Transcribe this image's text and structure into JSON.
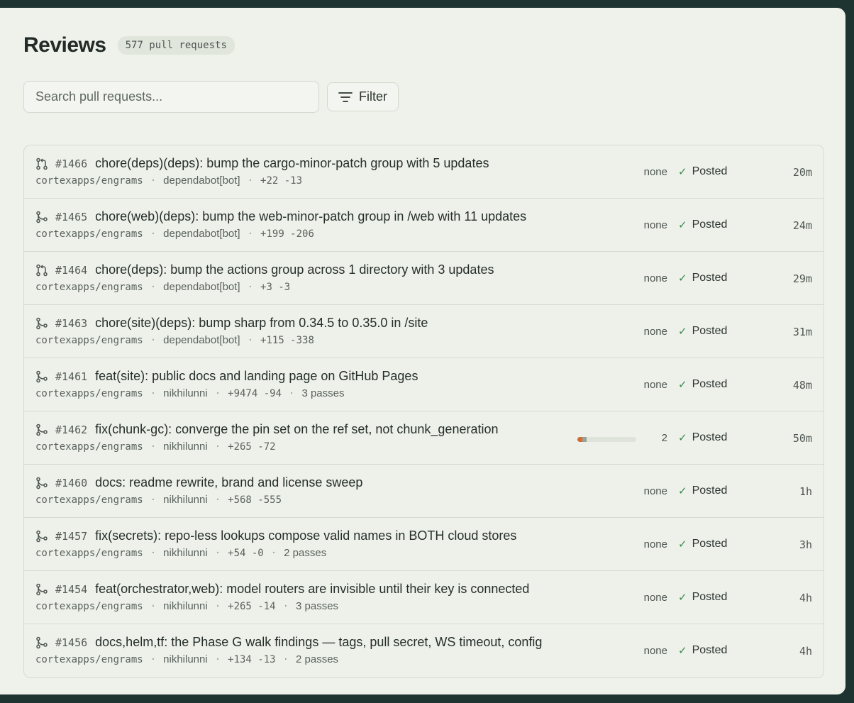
{
  "header": {
    "title": "Reviews",
    "count": "577 pull requests"
  },
  "toolbar": {
    "search_placeholder": "Search pull requests...",
    "filter_label": "Filter"
  },
  "rows": [
    {
      "icon": "pull-request-open-icon",
      "number": "#1466",
      "title": "chore(deps)(deps): bump the cargo-minor-patch group with 5 updates",
      "repo": "cortexapps/engrams",
      "author": "dependabot[bot]",
      "diff": "+22 -13",
      "passes": "",
      "risk": "none",
      "status": "Posted",
      "age": "20m"
    },
    {
      "icon": "pull-request-merged-icon",
      "number": "#1465",
      "title": "chore(web)(deps): bump the web-minor-patch group in /web with 11 updates",
      "repo": "cortexapps/engrams",
      "author": "dependabot[bot]",
      "diff": "+199 -206",
      "passes": "",
      "risk": "none",
      "status": "Posted",
      "age": "24m"
    },
    {
      "icon": "pull-request-open-icon",
      "number": "#1464",
      "title": "chore(deps): bump the actions group across 1 directory with 3 updates",
      "repo": "cortexapps/engrams",
      "author": "dependabot[bot]",
      "diff": "+3 -3",
      "passes": "",
      "risk": "none",
      "status": "Posted",
      "age": "29m"
    },
    {
      "icon": "pull-request-merged-icon",
      "number": "#1463",
      "title": "chore(site)(deps): bump sharp from 0.34.5 to 0.35.0 in /site",
      "repo": "cortexapps/engrams",
      "author": "dependabot[bot]",
      "diff": "+115 -338",
      "passes": "",
      "risk": "none",
      "status": "Posted",
      "age": "31m"
    },
    {
      "icon": "pull-request-merged-icon",
      "number": "#1461",
      "title": "feat(site): public docs and landing page on GitHub Pages",
      "repo": "cortexapps/engrams",
      "author": "nikhilunni",
      "diff": "+9474 -94",
      "passes": "3 passes",
      "risk": "none",
      "status": "Posted",
      "age": "48m"
    },
    {
      "icon": "pull-request-merged-icon",
      "number": "#1462",
      "title": "fix(chunk-gc): converge the pin set on the ref set, not chunk_generation",
      "repo": "cortexapps/engrams",
      "author": "nikhilunni",
      "diff": "+265 -72",
      "passes": "",
      "risk": "2",
      "progress": [
        0.08,
        0.08
      ],
      "status": "Posted",
      "age": "50m"
    },
    {
      "icon": "pull-request-merged-icon",
      "number": "#1460",
      "title": "docs: readme rewrite, brand and license sweep",
      "repo": "cortexapps/engrams",
      "author": "nikhilunni",
      "diff": "+568 -555",
      "passes": "",
      "risk": "none",
      "status": "Posted",
      "age": "1h"
    },
    {
      "icon": "pull-request-merged-icon",
      "number": "#1457",
      "title": "fix(secrets): repo-less lookups compose valid names in BOTH cloud stores",
      "repo": "cortexapps/engrams",
      "author": "nikhilunni",
      "diff": "+54 -0",
      "passes": "2 passes",
      "risk": "none",
      "status": "Posted",
      "age": "3h"
    },
    {
      "icon": "pull-request-merged-icon",
      "number": "#1454",
      "title": "feat(orchestrator,web): model routers are invisible until their key is connected",
      "repo": "cortexapps/engrams",
      "author": "nikhilunni",
      "diff": "+265 -14",
      "passes": "3 passes",
      "risk": "none",
      "status": "Posted",
      "age": "4h"
    },
    {
      "icon": "pull-request-merged-icon",
      "number": "#1456",
      "title": "docs,helm,tf: the Phase G walk findings — tags, pull secret, WS timeout, config",
      "repo": "cortexapps/engrams",
      "author": "nikhilunni",
      "diff": "+134 -13",
      "passes": "2 passes",
      "risk": "none",
      "status": "Posted",
      "age": "4h"
    }
  ]
}
